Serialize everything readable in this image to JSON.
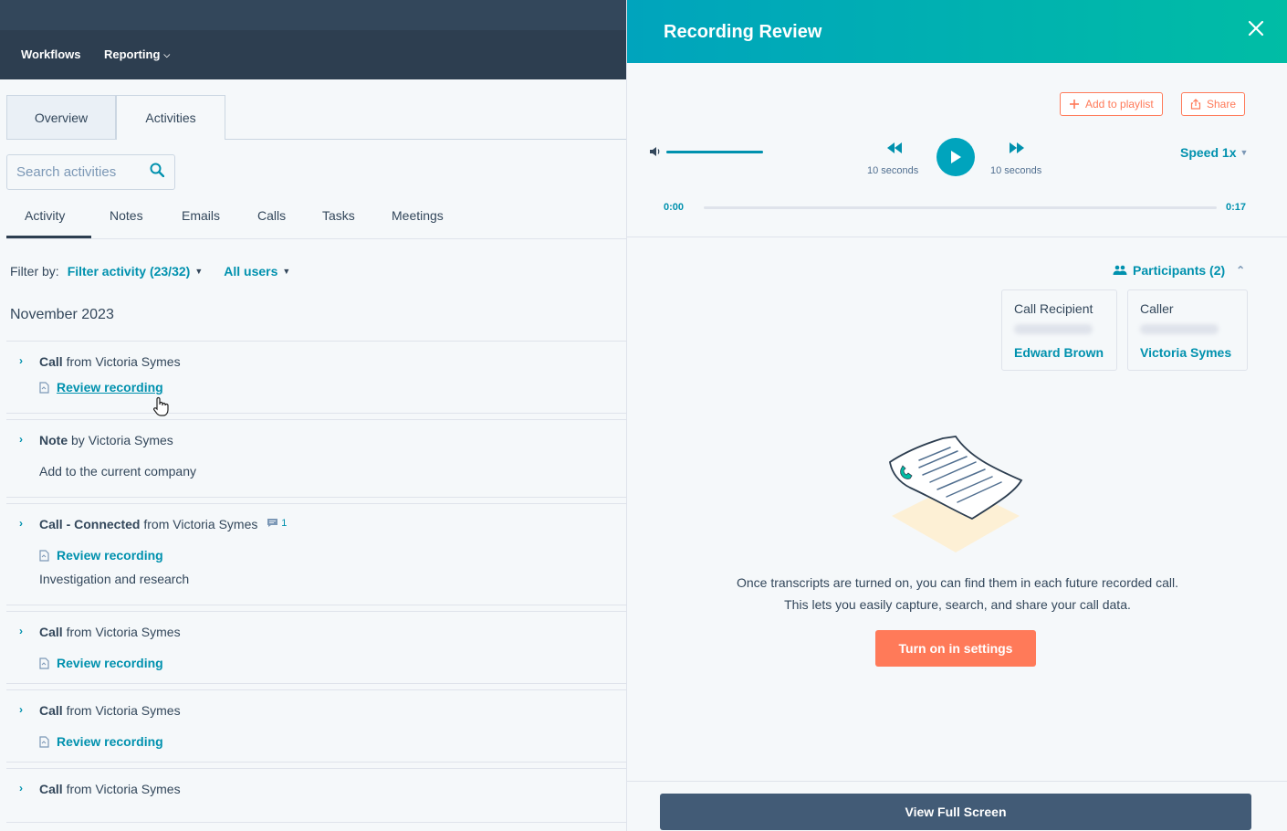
{
  "topnav": {
    "items": [
      {
        "label": "Workflows"
      },
      {
        "label": "Reporting",
        "has_dropdown": true
      }
    ]
  },
  "page_tabs": [
    {
      "label": "Overview",
      "active": false
    },
    {
      "label": "Activities",
      "active": true
    }
  ],
  "search": {
    "placeholder": "Search activities"
  },
  "activity_tabs": [
    {
      "label": "Activity",
      "active": true
    },
    {
      "label": "Notes"
    },
    {
      "label": "Emails"
    },
    {
      "label": "Calls"
    },
    {
      "label": "Tasks"
    },
    {
      "label": "Meetings"
    }
  ],
  "filter": {
    "label": "Filter by:",
    "activity": "Filter activity (23/32)",
    "users": "All users"
  },
  "month": "November 2023",
  "activities": [
    {
      "type": "Call",
      "connector": "from Victoria Symes",
      "link": "Review recording",
      "hover": true
    },
    {
      "type": "Note",
      "connector": "by Victoria Symes",
      "description": "Add to the current company"
    },
    {
      "type": "Call - Connected",
      "connector": "from Victoria Symes",
      "comments": "1",
      "link": "Review recording",
      "description": "Investigation and research"
    },
    {
      "type": "Call",
      "connector": "from Victoria Symes",
      "link": "Review recording"
    },
    {
      "type": "Call",
      "connector": "from Victoria Symes",
      "link": "Review recording"
    },
    {
      "type": "Call",
      "connector": "from Victoria Symes"
    }
  ],
  "panel": {
    "title": "Recording Review",
    "add_to_playlist": "Add to playlist",
    "share": "Share",
    "player": {
      "volume": 1.0,
      "rewind_label": "10 seconds",
      "forward_label": "10 seconds",
      "speed": "Speed 1x",
      "current_time": "0:00",
      "duration": "0:17",
      "progress": 0.0
    },
    "participants": {
      "title": "Participants (2)",
      "people": [
        {
          "role": "Call Recipient",
          "name": "Edward Brown"
        },
        {
          "role": "Caller",
          "name": "Victoria Symes"
        }
      ]
    },
    "transcript": {
      "line1": "Once transcripts are turned on, you can find them in each future recorded call.",
      "line2": "This lets you easily capture, search, and share your call data.",
      "button": "Turn on in settings"
    },
    "view_full_screen": "View Full Screen"
  },
  "colors": {
    "nav_bg": "#2d3e50",
    "link": "#0091ae",
    "header_gradient_start": "#00a4bd",
    "header_gradient_end": "#00bda5",
    "primary_button": "#ff7a59",
    "secondary_button": "#425b76"
  }
}
